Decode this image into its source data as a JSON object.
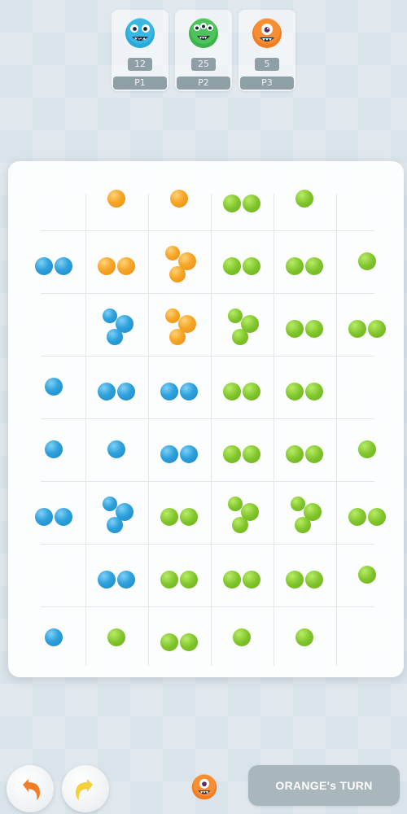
{
  "players": [
    {
      "id": "p1",
      "label": "P1",
      "score": "12",
      "monster": "blue-monster-icon"
    },
    {
      "id": "p2",
      "label": "P2",
      "score": "25",
      "monster": "green-monster-icon"
    },
    {
      "id": "p3",
      "label": "P3",
      "score": "5",
      "monster": "orange-monster-icon"
    }
  ],
  "colors": {
    "blue": "#2ea1dc",
    "green": "#81c52c",
    "orange": "#f6a627",
    "undo_orange": "#f07d2a",
    "redo_yellow": "#f2d13a"
  },
  "board": {
    "rows": 8,
    "cols": 6,
    "cells": [
      {
        "row": 0,
        "col": 1,
        "color": "orange",
        "count": 1
      },
      {
        "row": 0,
        "col": 2,
        "color": "orange",
        "count": 1
      },
      {
        "row": 0,
        "col": 3,
        "color": "green",
        "count": 2
      },
      {
        "row": 0,
        "col": 4,
        "color": "green",
        "count": 1
      },
      {
        "row": 1,
        "col": 0,
        "color": "blue",
        "count": 2
      },
      {
        "row": 1,
        "col": 1,
        "color": "orange",
        "count": 2
      },
      {
        "row": 1,
        "col": 2,
        "color": "orange",
        "count": 3
      },
      {
        "row": 1,
        "col": 3,
        "color": "green",
        "count": 2
      },
      {
        "row": 1,
        "col": 4,
        "color": "green",
        "count": 2
      },
      {
        "row": 1,
        "col": 5,
        "color": "green",
        "count": 1
      },
      {
        "row": 2,
        "col": 1,
        "color": "blue",
        "count": 3
      },
      {
        "row": 2,
        "col": 2,
        "color": "orange",
        "count": 3
      },
      {
        "row": 2,
        "col": 3,
        "color": "green",
        "count": 3
      },
      {
        "row": 2,
        "col": 4,
        "color": "green",
        "count": 2
      },
      {
        "row": 2,
        "col": 5,
        "color": "green",
        "count": 2
      },
      {
        "row": 3,
        "col": 0,
        "color": "blue",
        "count": 1
      },
      {
        "row": 3,
        "col": 1,
        "color": "blue",
        "count": 2
      },
      {
        "row": 3,
        "col": 2,
        "color": "blue",
        "count": 2
      },
      {
        "row": 3,
        "col": 3,
        "color": "green",
        "count": 2
      },
      {
        "row": 3,
        "col": 4,
        "color": "green",
        "count": 2
      },
      {
        "row": 4,
        "col": 0,
        "color": "blue",
        "count": 1
      },
      {
        "row": 4,
        "col": 1,
        "color": "blue",
        "count": 1
      },
      {
        "row": 4,
        "col": 2,
        "color": "blue",
        "count": 2
      },
      {
        "row": 4,
        "col": 3,
        "color": "green",
        "count": 2
      },
      {
        "row": 4,
        "col": 4,
        "color": "green",
        "count": 2
      },
      {
        "row": 4,
        "col": 5,
        "color": "green",
        "count": 1
      },
      {
        "row": 5,
        "col": 0,
        "color": "blue",
        "count": 2
      },
      {
        "row": 5,
        "col": 1,
        "color": "blue",
        "count": 3
      },
      {
        "row": 5,
        "col": 2,
        "color": "green",
        "count": 2
      },
      {
        "row": 5,
        "col": 3,
        "color": "green",
        "count": 3
      },
      {
        "row": 5,
        "col": 4,
        "color": "green",
        "count": 3
      },
      {
        "row": 5,
        "col": 5,
        "color": "green",
        "count": 2
      },
      {
        "row": 6,
        "col": 1,
        "color": "blue",
        "count": 2
      },
      {
        "row": 6,
        "col": 2,
        "color": "green",
        "count": 2
      },
      {
        "row": 6,
        "col": 3,
        "color": "green",
        "count": 2
      },
      {
        "row": 6,
        "col": 4,
        "color": "green",
        "count": 2
      },
      {
        "row": 6,
        "col": 5,
        "color": "green",
        "count": 1
      },
      {
        "row": 7,
        "col": 0,
        "color": "blue",
        "count": 1
      },
      {
        "row": 7,
        "col": 1,
        "color": "green",
        "count": 1
      },
      {
        "row": 7,
        "col": 2,
        "color": "green",
        "count": 2
      },
      {
        "row": 7,
        "col": 3,
        "color": "green",
        "count": 1
      },
      {
        "row": 7,
        "col": 4,
        "color": "green",
        "count": 1
      }
    ]
  },
  "controls": {
    "undo_icon": "undo-arrow-icon",
    "redo_icon": "redo-arrow-icon",
    "turn_monster": "orange-monster-icon",
    "turn_label": "ORANGE's TURN"
  }
}
